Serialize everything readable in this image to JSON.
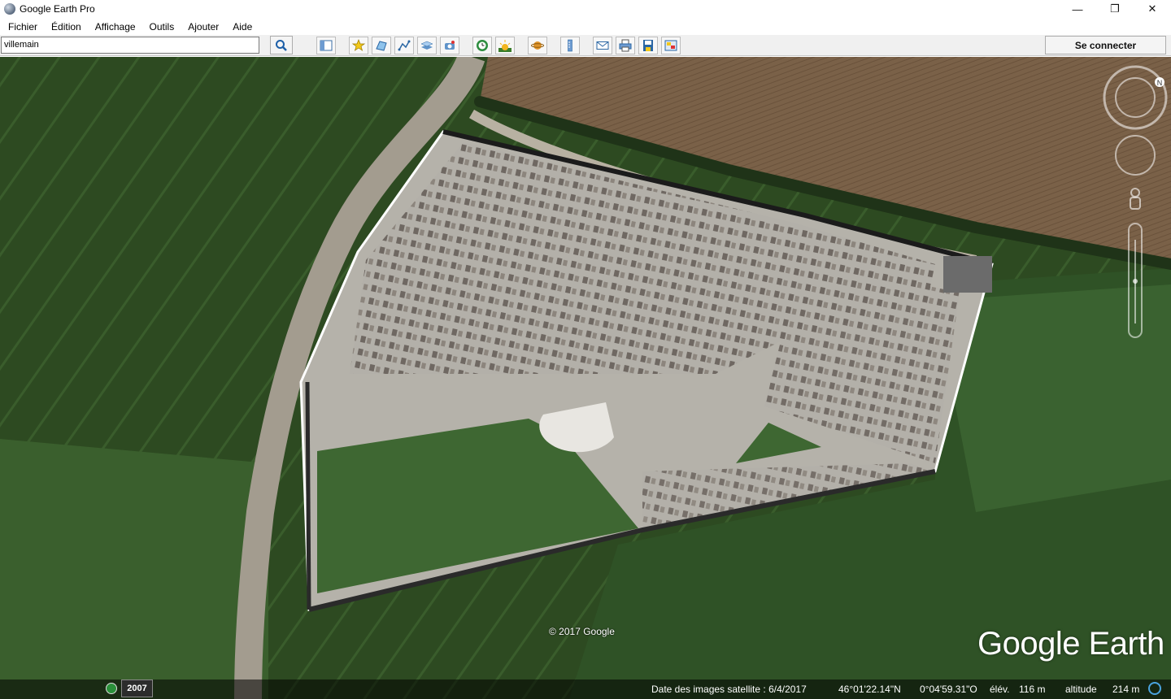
{
  "window": {
    "title": "Google Earth Pro",
    "controls": [
      "minimize-icon",
      "restore-icon",
      "close-icon"
    ]
  },
  "menu": [
    "Fichier",
    "Édition",
    "Affichage",
    "Outils",
    "Ajouter",
    "Aide"
  ],
  "search": {
    "value": "villemain",
    "button_icon": "search-icon"
  },
  "toolbar": {
    "icons": [
      "sidebar-icon",
      "placemark-icon",
      "polygon-icon",
      "path-icon",
      "overlay-icon",
      "tour-icon",
      "historical-imagery-icon",
      "sunlight-icon",
      "planets-icon",
      "ruler-icon",
      "email-icon",
      "print-icon",
      "save-image-icon",
      "view-in-maps-icon"
    ],
    "connect_label": "Se connecter"
  },
  "map": {
    "copyright": "© 2017 Google",
    "logo": "Google Earth",
    "year": "2007",
    "status": {
      "imagery_date": "Date des images satellite : 6/4/2017",
      "lat": "46°01'22.14\"N",
      "lon": "0°04'59.31\"O",
      "elev_label": "élév.",
      "elev_value": "116 m",
      "alt_label": "altitude",
      "alt_value": "214 m"
    },
    "nav_controls": [
      "north-icon",
      "look-joystick-icon",
      "move-joystick-icon",
      "pegman-icon",
      "zoom-slider-icon"
    ]
  },
  "colors": {
    "field_dark": "#2e4a22",
    "field_mid": "#3d6030",
    "plowed": "#7a6148",
    "cemetery_ground": "#b5b2aa",
    "road": "#a39c8f"
  }
}
